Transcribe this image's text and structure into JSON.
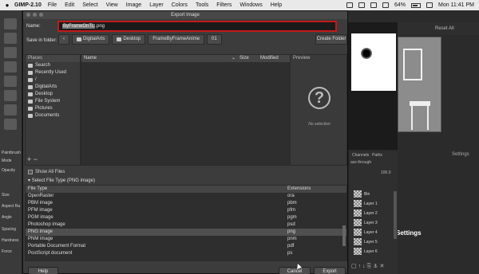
{
  "menubar": {
    "app": "GIMP-2.10",
    "items": [
      "File",
      "Edit",
      "Select",
      "View",
      "Image",
      "Layer",
      "Colors",
      "Tools",
      "Filters",
      "Windows",
      "Help"
    ],
    "battery": "64%",
    "clock": "Mon 11:41 PM"
  },
  "toolbox": {
    "labels": [
      "Paintbrush",
      "Mode",
      "Opacity",
      "Size",
      "Aspect Ra",
      "Angle",
      "Spacing",
      "Hardness",
      "Force"
    ]
  },
  "dialog": {
    "title": "Export Image",
    "name_label": "Name:",
    "name_selected": "ByFrameOnTL",
    "name_ext": ".png",
    "folder_label": "Save in folder:",
    "crumbs": [
      "DigitalArts",
      "Desktop",
      "FrameByFrameAnime",
      "01"
    ],
    "create_folder": "Create Folder",
    "places_header": "Places",
    "places": [
      "Search",
      "Recently Used",
      "/",
      "DigitalArts",
      "Desktop",
      "File System",
      "Pictures",
      "Documents"
    ],
    "places_controls": "+ −",
    "filelist": {
      "name": "Name",
      "size": "Size",
      "modified": "Modified"
    },
    "preview_header": "Preview",
    "preview_empty": "No selection",
    "show_all": "Show All Files",
    "select_file_type": "Select File Type (PNG image)",
    "type_header": "File Type",
    "ext_header": "Extensions",
    "types": [
      {
        "type": "OpenRaster",
        "ext": "ora"
      },
      {
        "type": "PBM image",
        "ext": "pbm"
      },
      {
        "type": "PFM image",
        "ext": "pfm"
      },
      {
        "type": "PGM image",
        "ext": "pgm"
      },
      {
        "type": "Photoshop image",
        "ext": "psd"
      },
      {
        "type": "PNG image",
        "ext": "png"
      },
      {
        "type": "PNM image",
        "ext": "pnm"
      },
      {
        "type": "Portable Document Format",
        "ext": "pdf"
      },
      {
        "type": "PostScript document",
        "ext": "ps"
      }
    ],
    "help": "Help",
    "cancel": "Cancel",
    "export": "Export"
  },
  "right": {
    "reset_all": "Reset All",
    "settings_small": "Settings",
    "settings_big": "Settings",
    "tabs": [
      "Channels",
      "Paths"
    ],
    "mode": "ass through",
    "opacity": "100.0",
    "layers": [
      "Bin",
      "Layer 1",
      "Layer 2",
      "Layer 3",
      "Layer 4",
      "Layer 5",
      "Layer 6"
    ]
  }
}
